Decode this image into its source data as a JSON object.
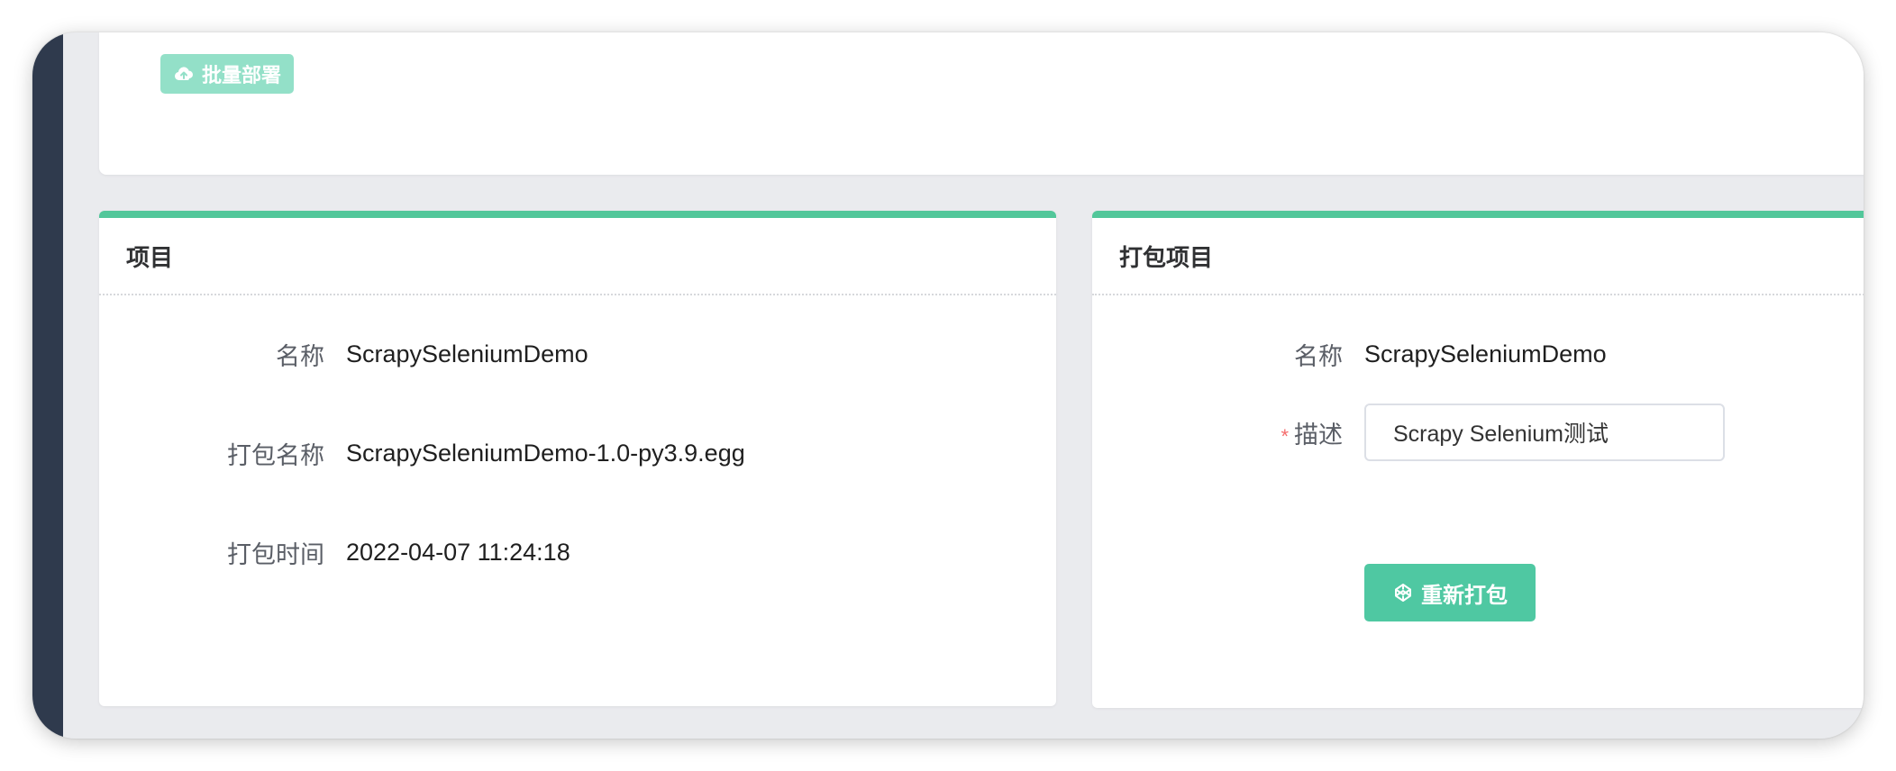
{
  "toolbar": {
    "batch_deploy_label": "批量部署",
    "batch_deploy_icon": "cloud-upload-icon"
  },
  "project_card": {
    "title": "项目",
    "fields": [
      {
        "label": "名称",
        "value": "ScrapySeleniumDemo"
      },
      {
        "label": "打包名称",
        "value": "ScrapySeleniumDemo-1.0-py3.9.egg"
      },
      {
        "label": "打包时间",
        "value": "2022-04-07 11:24:18"
      }
    ]
  },
  "package_card": {
    "title": "打包项目",
    "name_label": "名称",
    "name_value": "ScrapySeleniumDemo",
    "required_mark": "*",
    "desc_label": "描述",
    "desc_value": "Scrapy Selenium测试",
    "repack_label": "重新打包",
    "repack_icon": "codepen-icon"
  },
  "colors": {
    "accent": "#52c79a",
    "button": "#4fc8a2",
    "button_disabled": "#93e0c8",
    "sidebar": "#2f3a4d",
    "required": "#f56c6c"
  }
}
